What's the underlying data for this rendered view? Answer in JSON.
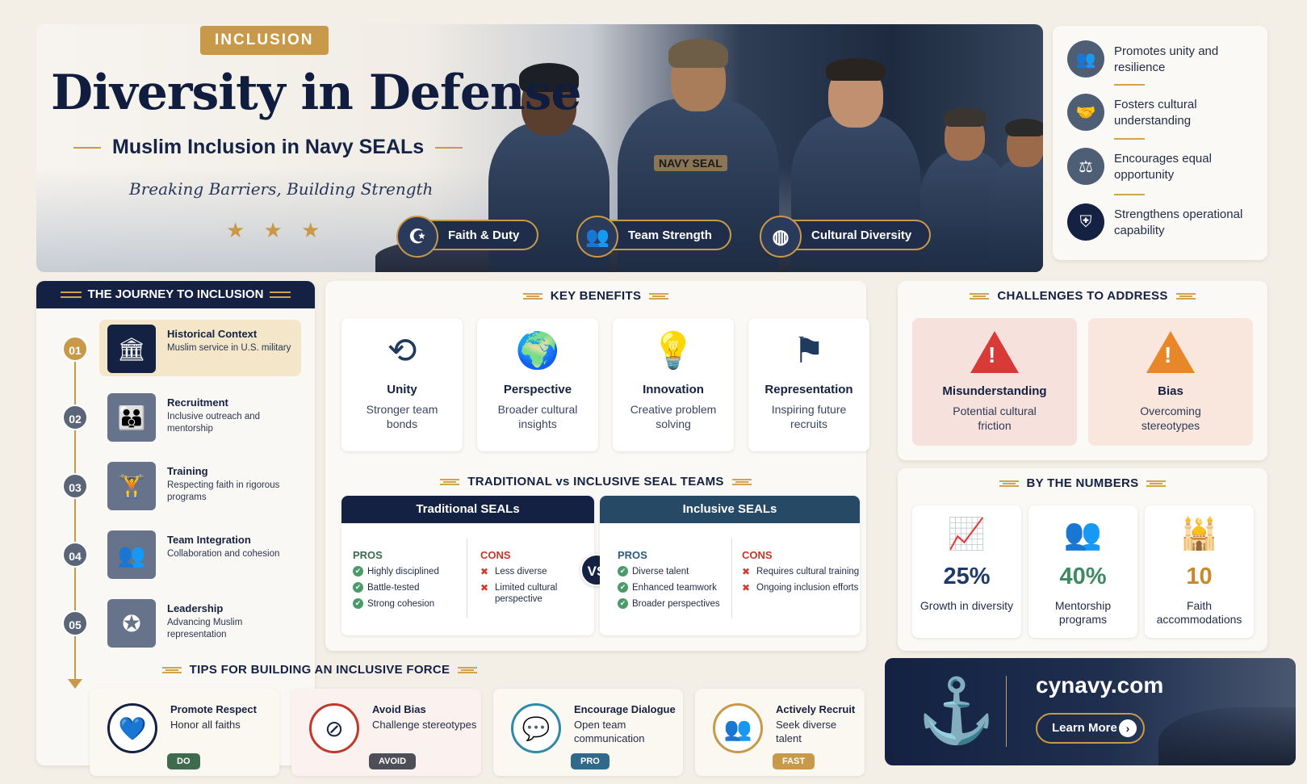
{
  "hero": {
    "tag": "INCLUSION",
    "title": "Diversity in Defense",
    "subtitle": "Muslim Inclusion in Navy SEALs",
    "tagline": "Breaking Barriers, Building Strength",
    "stars": "★ ★ ★",
    "vest_text": "NAVY SEAL",
    "pills": [
      {
        "label": "Faith & Duty",
        "icon": "moon-star-icon"
      },
      {
        "label": "Team Strength",
        "icon": "team-icon"
      },
      {
        "label": "Cultural Diversity",
        "icon": "globe-icon"
      }
    ]
  },
  "benefit_list": [
    {
      "text": "Promotes unity and resilience",
      "icon": "group-icon"
    },
    {
      "text": "Fosters cultural understanding",
      "icon": "handshake-icon"
    },
    {
      "text": "Encourages equal opportunity",
      "icon": "scales-icon"
    },
    {
      "text": "Strengthens operational capability",
      "icon": "shield-icon"
    }
  ],
  "journey": {
    "title": "THE JOURNEY TO INCLUSION",
    "steps": [
      {
        "num": "01",
        "title": "Historical Context",
        "desc": "Muslim service in U.S. military",
        "icon": "building-icon"
      },
      {
        "num": "02",
        "title": "Recruitment",
        "desc": "Inclusive outreach and mentorship",
        "icon": "people-icon"
      },
      {
        "num": "03",
        "title": "Training",
        "desc": "Respecting faith in rigorous programs",
        "icon": "pushup-icon"
      },
      {
        "num": "04",
        "title": "Team Integration",
        "desc": "Collaboration and cohesion",
        "icon": "team-icon"
      },
      {
        "num": "05",
        "title": "Leadership",
        "desc": "Advancing Muslim representation",
        "icon": "chevron-rank-icon"
      }
    ]
  },
  "key_benefits": {
    "title": "KEY BENEFITS",
    "items": [
      {
        "title": "Unity",
        "desc": "Stronger team bonds",
        "icon": "unity-icon"
      },
      {
        "title": "Perspective",
        "desc": "Broader cultural insights",
        "icon": "globe-icon"
      },
      {
        "title": "Innovation",
        "desc": "Creative problem solving",
        "icon": "lightbulb-icon"
      },
      {
        "title": "Representation",
        "desc": "Inspiring future recruits",
        "icon": "flag-person-icon"
      }
    ]
  },
  "comparison": {
    "title": "TRADITIONAL vs INCLUSIVE SEAL TEAMS",
    "vs": "VS",
    "traditional": {
      "header": "Traditional SEALs",
      "pros_label": "PROS",
      "pros": [
        "Highly disciplined",
        "Battle-tested",
        "Strong cohesion"
      ],
      "cons_label": "CONS",
      "cons": [
        "Less diverse",
        "Limited cultural perspective"
      ]
    },
    "inclusive": {
      "header": "Inclusive SEALs",
      "pros_label": "PROS",
      "pros": [
        "Diverse talent",
        "Enhanced teamwork",
        "Broader perspectives"
      ],
      "cons_label": "CONS",
      "cons": [
        "Requires cultural training",
        "Ongoing inclusion efforts"
      ]
    }
  },
  "challenges": {
    "title": "CHALLENGES TO ADDRESS",
    "items": [
      {
        "title": "Misunderstanding",
        "desc": "Potential cultural friction",
        "color": "#d83a38"
      },
      {
        "title": "Bias",
        "desc": "Overcoming stereotypes",
        "color": "#e8862a"
      }
    ]
  },
  "numbers": {
    "title": "BY THE NUMBERS",
    "items": [
      {
        "value": "25%",
        "desc": "Growth in diversity",
        "color": "#1f3a6a",
        "icon": "growth-chart-icon"
      },
      {
        "value": "40%",
        "desc": "Mentorship programs",
        "color": "#3e8a62",
        "icon": "people-icon"
      },
      {
        "value": "10",
        "desc": "Faith accommodations",
        "color": "#c9882a",
        "icon": "mosque-icon"
      }
    ]
  },
  "tips": {
    "title": "TIPS FOR BUILDING AN INCLUSIVE FORCE",
    "items": [
      {
        "title": "Promote Respect",
        "desc": "Honor all faiths",
        "badge": "DO",
        "badge_color": "#3e6a4e",
        "icon": "heart-handshake-icon"
      },
      {
        "title": "Avoid Bias",
        "desc": "Challenge stereotypes",
        "badge": "AVOID",
        "badge_color": "#4e4e58",
        "icon": "no-bias-icon"
      },
      {
        "title": "Encourage Dialogue",
        "desc": "Open team communication",
        "badge": "PRO",
        "badge_color": "#2f6a8a",
        "icon": "chat-icon"
      },
      {
        "title": "Actively Recruit",
        "desc": "Seek diverse talent",
        "badge": "FAST",
        "badge_color": "#c9994a",
        "icon": "recruit-icon"
      }
    ]
  },
  "cta": {
    "url": "cynavy.com",
    "button": "Learn More",
    "icon": "anchor-icon"
  }
}
